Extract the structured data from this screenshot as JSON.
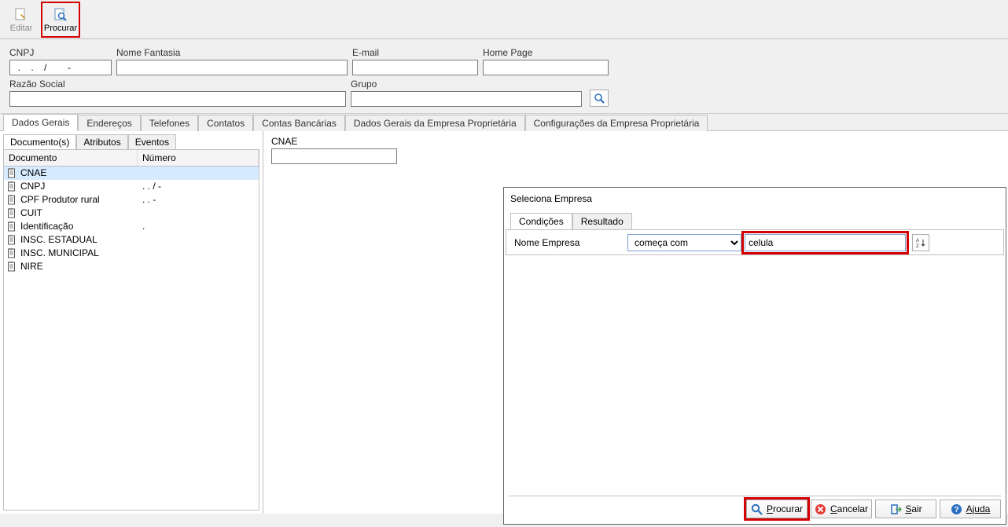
{
  "toolbar": {
    "editar_label": "Editar",
    "procurar_label": "Procurar"
  },
  "form": {
    "cnpj_label": "CNPJ",
    "cnpj_value": "  .    .    /        -",
    "nome_fantasia_label": "Nome Fantasia",
    "email_label": "E-mail",
    "home_page_label": "Home Page",
    "razao_social_label": "Razão Social",
    "grupo_label": "Grupo"
  },
  "main_tabs": [
    "Dados Gerais",
    "Endereços",
    "Telefones",
    "Contatos",
    "Contas Bancárias",
    "Dados Gerais da Empresa Proprietária",
    "Configurações da Empresa Proprietária"
  ],
  "sub_tabs": [
    "Documento(s)",
    "Atributos",
    "Eventos"
  ],
  "doc_grid": {
    "col_doc": "Documento",
    "col_num": "Número",
    "rows": [
      {
        "doc": "CNAE",
        "num": ""
      },
      {
        "doc": "CNPJ",
        "num": "  .    .    /        -"
      },
      {
        "doc": "CPF Produtor rural",
        "num": "   .    .    -"
      },
      {
        "doc": "CUIT",
        "num": ""
      },
      {
        "doc": "Identificação",
        "num": "."
      },
      {
        "doc": "INSC. ESTADUAL",
        "num": ""
      },
      {
        "doc": "INSC. MUNICIPAL",
        "num": ""
      },
      {
        "doc": "NIRE",
        "num": ""
      }
    ]
  },
  "cnae_label": "CNAE",
  "dialog": {
    "title": "Seleciona Empresa",
    "tab_cond": "Condições",
    "tab_res": "Resultado",
    "field_label": "Nome Empresa",
    "operator": "começa com",
    "search_value": "celula",
    "btn_procurar": "Procurar",
    "btn_cancelar": "Cancelar",
    "btn_sair": "Sair",
    "btn_ajuda": "Ajuda"
  }
}
